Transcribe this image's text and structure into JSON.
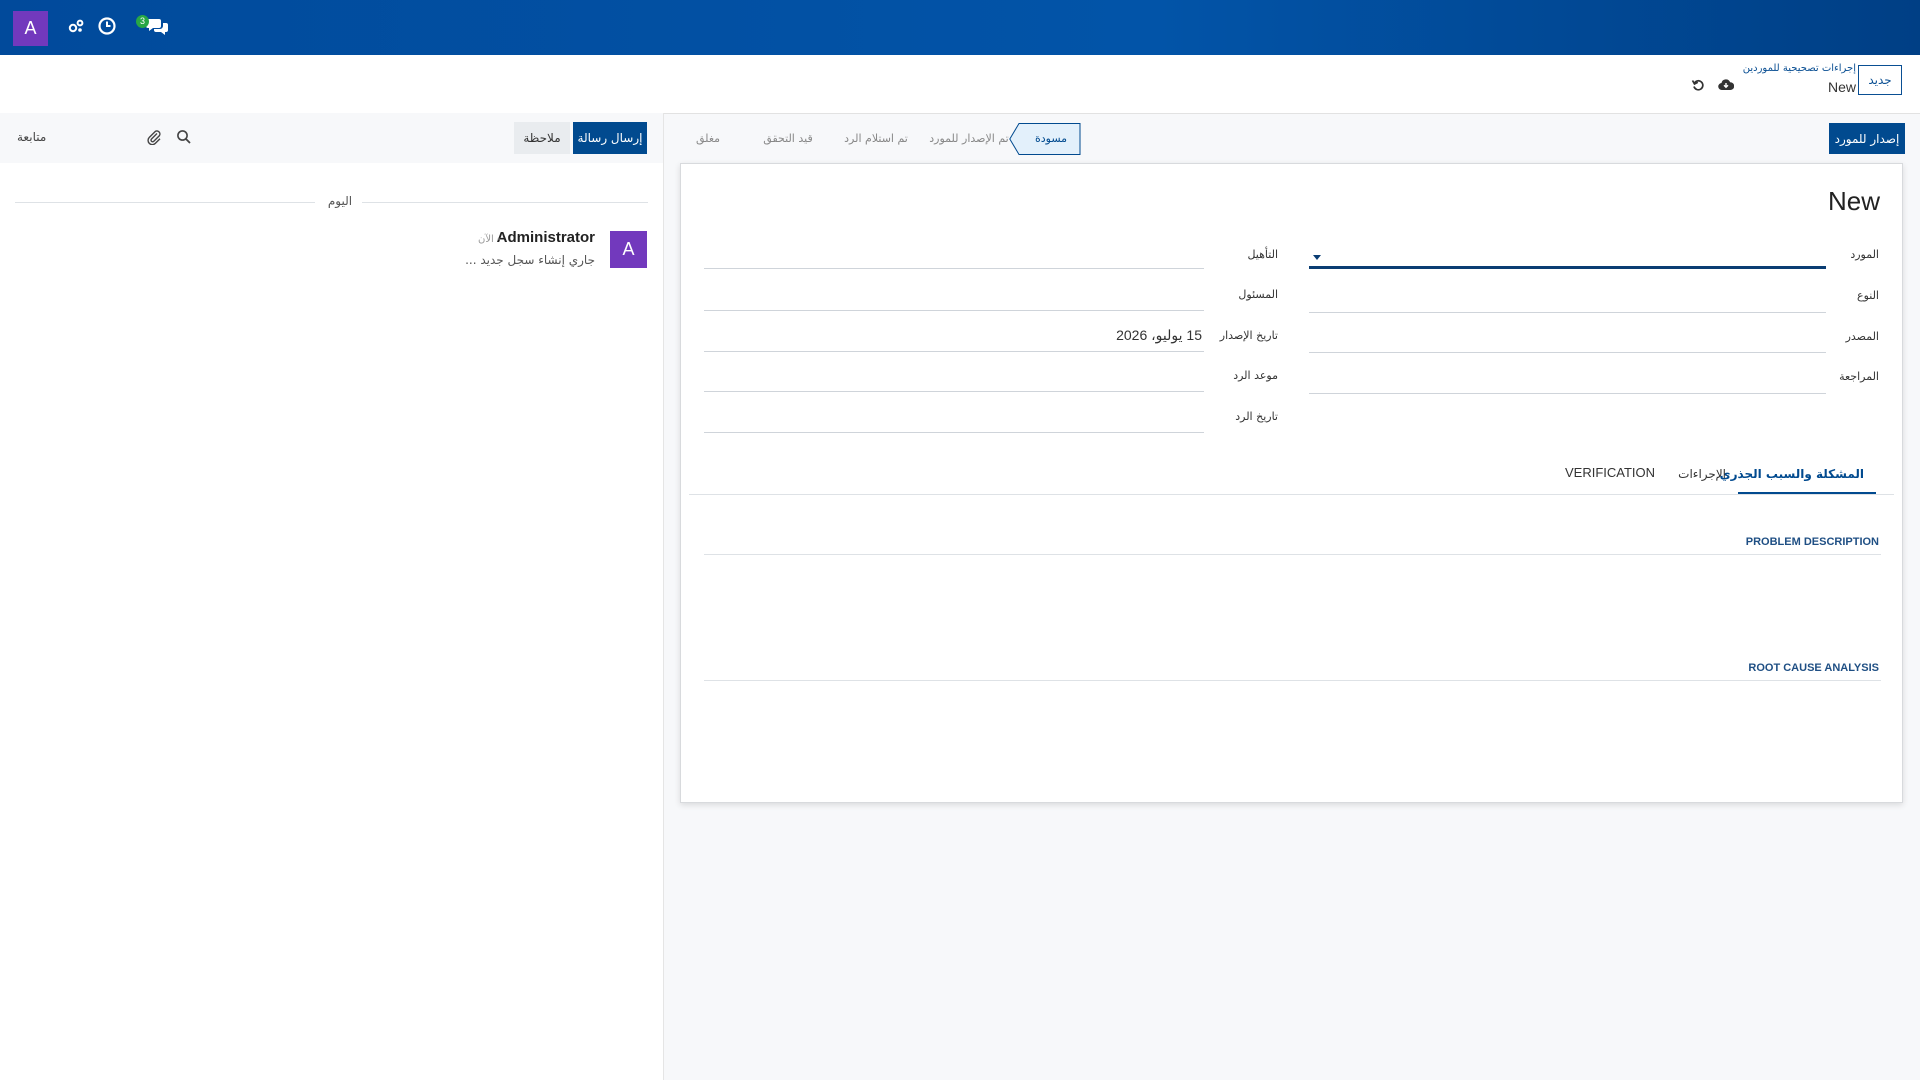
{
  "topbar": {
    "avatar_letter": "A",
    "icons": [
      "activity-icon",
      "clock-icon",
      "chat-icon"
    ],
    "messages_count": "3",
    "background": "#014a9b",
    "avatar_color": "#7239bd"
  },
  "control_panel": {
    "new_button": "جديد",
    "breadcrumb_parent": "إجراءات تصحيحية للموردين",
    "breadcrumb_current": "New",
    "icons": [
      "cloud-save-icon",
      "discard-icon"
    ]
  },
  "chatter": {
    "follow_label": "متابعة",
    "note_button": "ملاحظة",
    "send_button": "إرسال رسالة",
    "today_label": "اليوم",
    "message": {
      "avatar_letter": "A",
      "author": "Administrator",
      "time": "- الآن",
      "body": "جاري إنشاء سجل جديد ..."
    }
  },
  "status": {
    "issue_button": "إصدار للمورد",
    "stages": [
      "مسودة",
      "تم الإصدار للمورد",
      "تم استلام الرد",
      "قيد التحقق",
      "مغلق"
    ],
    "active_stage": "مسودة"
  },
  "form": {
    "title": "New",
    "fields": {
      "supplier": {
        "label": "المورد",
        "value": ""
      },
      "type": {
        "label": "النوع",
        "value": ""
      },
      "source": {
        "label": "المصدر",
        "value": ""
      },
      "review": {
        "label": "المراجعة",
        "value": ""
      },
      "qualification": {
        "label": "التأهيل",
        "value": ""
      },
      "responsible": {
        "label": "المسئول",
        "value": ""
      },
      "issue_date": {
        "label": "تاريخ الإصدار",
        "value": "15 يوليو، 2026"
      },
      "response_deadline": {
        "label": "موعد الرد",
        "value": ""
      },
      "response_date": {
        "label": "تاريخ الرد",
        "value": ""
      }
    },
    "tabs": [
      "المشكلة والسبب الجذري",
      "الإجراءات",
      "VERIFICATION"
    ],
    "active_tab": "المشكلة والسبب الجذري",
    "sections": {
      "problem": "PROBLEM DESCRIPTION",
      "root_cause": "ROOT CAUSE ANALYSIS"
    }
  }
}
